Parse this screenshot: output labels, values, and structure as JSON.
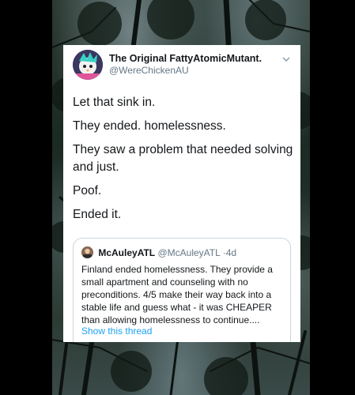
{
  "tweet": {
    "display_name": "The Original FattyAtomicMutant.",
    "handle": "@WereChickenAU",
    "lines": [
      "Let that sink in.",
      "They ended. homelessness.",
      "They saw a problem that needed solving and just.",
      "Poof.",
      "Ended it."
    ]
  },
  "quoted_tweet": {
    "display_name": "McAuleyATL",
    "handle": "@McAuleyATL",
    "separator": "·",
    "age": "4d",
    "text": "Finland ended homelessness. They provide a small apartment and counseling with no preconditions. 4/5 make their way back into a stable life and guess what - it was CHEAPER than allowing homelessness to continue....",
    "show_thread_label": "Show this thread"
  },
  "icons": {
    "avatar": "profile-avatar",
    "menu": "chevron-down-icon",
    "quoted_avatar": "profile-avatar"
  },
  "colors": {
    "link": "#1da1f2",
    "secondary_text": "#657786",
    "primary_text": "#14171a"
  }
}
